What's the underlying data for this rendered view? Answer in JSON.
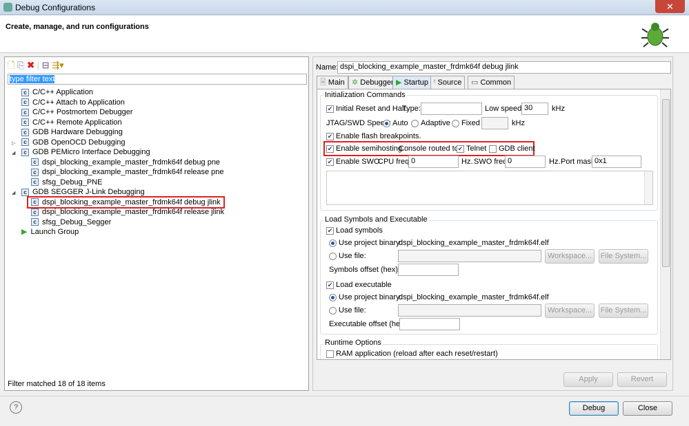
{
  "window": {
    "title": "Debug Configurations",
    "close": "✕"
  },
  "header": {
    "title": "Create, manage, and run configurations"
  },
  "left": {
    "filter": "type filter text",
    "tree": [
      {
        "label": "C/C++ Application",
        "level": 0,
        "expander": ""
      },
      {
        "label": "C/C++ Attach to Application",
        "level": 0,
        "expander": ""
      },
      {
        "label": "C/C++ Postmortem Debugger",
        "level": 0,
        "expander": ""
      },
      {
        "label": "C/C++ Remote Application",
        "level": 0,
        "expander": ""
      },
      {
        "label": "GDB Hardware Debugging",
        "level": 0,
        "expander": ""
      },
      {
        "label": "GDB OpenOCD Debugging",
        "level": 0,
        "expander": "▷"
      },
      {
        "label": "GDB PEMicro Interface Debugging",
        "level": 0,
        "expander": "◢"
      },
      {
        "label": "dspi_blocking_example_master_frdmk64f debug pne",
        "level": 1,
        "expander": ""
      },
      {
        "label": "dspi_blocking_example_master_frdmk64f release pne",
        "level": 1,
        "expander": ""
      },
      {
        "label": "sfsg_Debug_PNE",
        "level": 1,
        "expander": ""
      },
      {
        "label": "GDB SEGGER J-Link Debugging",
        "level": 0,
        "expander": "◢"
      },
      {
        "label": "dspi_blocking_example_master_frdmk64f debug jlink",
        "level": 1,
        "expander": "",
        "selected": true
      },
      {
        "label": "dspi_blocking_example_master_frdmk64f release jlink",
        "level": 1,
        "expander": ""
      },
      {
        "label": "sfsg_Debug_Segger",
        "level": 1,
        "expander": ""
      },
      {
        "label": "Launch Group",
        "level": 0,
        "expander": "",
        "icon": "launch"
      }
    ],
    "status": "Filter matched 18 of 18 items"
  },
  "right": {
    "name_label": "Name:",
    "name_value": "dspi_blocking_example_master_frdmk64f debug jlink",
    "tabs": [
      "Main",
      "Debugger",
      "Startup",
      "Source",
      "Common"
    ],
    "init": {
      "title": "Initialization Commands",
      "reset": "Initial Reset and Halt.",
      "type_label": "Type:",
      "type_value": "",
      "low_label": "Low speed:",
      "low_value": "30",
      "khz": "kHz",
      "jtag_label": "JTAG/SWD Speed:",
      "auto": "Auto",
      "adaptive": "Adaptive",
      "fixed": "Fixed",
      "fixed_value": "",
      "flash": "Enable flash breakpoints.",
      "semi": "Enable semihosting.",
      "console": "Console routed to:",
      "telnet": "Telnet",
      "gdb": "GDB client",
      "swo": "Enable SWO.",
      "cpu_label": "CPU freq:",
      "cpu_value": "0",
      "hz": "Hz.",
      "swo_label": "SWO freq:",
      "swo_value": "0",
      "mask_label": "Port mask:",
      "mask_value": "0x1"
    },
    "load": {
      "title": "Load Symbols and Executable",
      "load_symbols": "Load symbols",
      "use_proj": "Use project binary:",
      "binary": "dspi_blocking_example_master_frdmk64f.elf",
      "use_file": "Use file:",
      "workspace": "Workspace...",
      "filesystem": "File System...",
      "sym_offset": "Symbols offset (hex):",
      "load_exec": "Load executable",
      "exec_offset": "Executable offset (hex):"
    },
    "runtime": {
      "title": "Runtime Options",
      "ram": "RAM application (reload after each reset/restart)"
    },
    "apply": "Apply",
    "revert": "Revert"
  },
  "footer": {
    "help": "?",
    "debug": "Debug",
    "close": "Close"
  }
}
